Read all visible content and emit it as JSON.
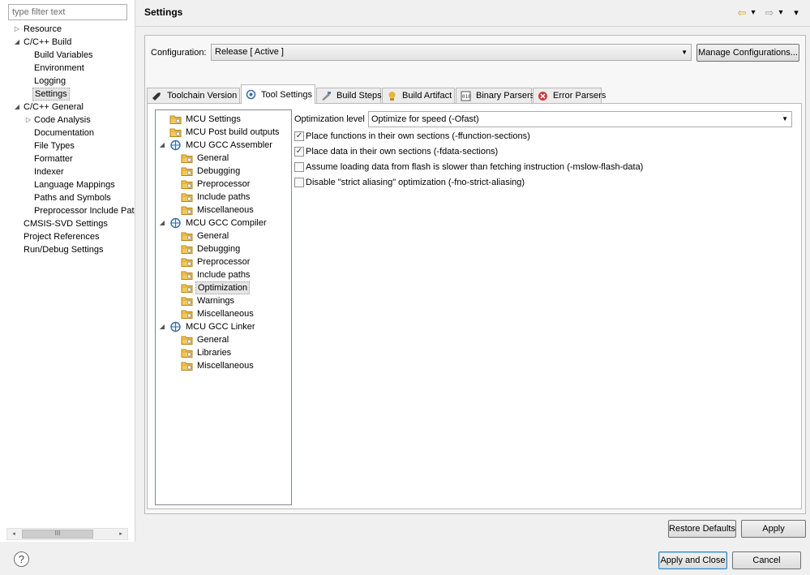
{
  "filter": {
    "placeholder": "type filter text"
  },
  "nav": {
    "items": [
      {
        "label": "Resource",
        "level": 1,
        "toggle": "▷",
        "selected": false
      },
      {
        "label": "C/C++ Build",
        "level": 1,
        "toggle": "◢",
        "selected": false
      },
      {
        "label": "Build Variables",
        "level": 2,
        "toggle": "",
        "selected": false
      },
      {
        "label": "Environment",
        "level": 2,
        "toggle": "",
        "selected": false
      },
      {
        "label": "Logging",
        "level": 2,
        "toggle": "",
        "selected": false
      },
      {
        "label": "Settings",
        "level": 2,
        "toggle": "",
        "selected": true
      },
      {
        "label": "C/C++ General",
        "level": 1,
        "toggle": "◢",
        "selected": false
      },
      {
        "label": "Code Analysis",
        "level": 2,
        "toggle": "▷",
        "selected": false
      },
      {
        "label": "Documentation",
        "level": 2,
        "toggle": "",
        "selected": false
      },
      {
        "label": "File Types",
        "level": 2,
        "toggle": "",
        "selected": false
      },
      {
        "label": "Formatter",
        "level": 2,
        "toggle": "",
        "selected": false
      },
      {
        "label": "Indexer",
        "level": 2,
        "toggle": "",
        "selected": false
      },
      {
        "label": "Language Mappings",
        "level": 2,
        "toggle": "",
        "selected": false
      },
      {
        "label": "Paths and Symbols",
        "level": 2,
        "toggle": "",
        "selected": false
      },
      {
        "label": "Preprocessor Include Pat",
        "level": 2,
        "toggle": "",
        "selected": false
      },
      {
        "label": "CMSIS-SVD Settings",
        "level": 1,
        "toggle": "",
        "selected": false
      },
      {
        "label": "Project References",
        "level": 1,
        "toggle": "",
        "selected": false
      },
      {
        "label": "Run/Debug Settings",
        "level": 1,
        "toggle": "",
        "selected": false
      }
    ]
  },
  "header": {
    "title": "Settings",
    "back_icon": "back-arrow-icon",
    "forward_icon": "forward-arrow-icon",
    "back_glyph": "⇦",
    "forward_glyph": "⇨",
    "menu_glyph": "▾"
  },
  "config": {
    "label": "Configuration:",
    "value": "Release  [ Active ]",
    "manage_label": "Manage Configurations..."
  },
  "tabs": [
    {
      "label": "Toolchain  Version",
      "icon": "toolchain-icon",
      "active": false
    },
    {
      "label": "Tool Settings",
      "icon": "tool-settings-icon",
      "active": true
    },
    {
      "label": "Build Steps",
      "icon": "build-steps-icon",
      "active": false
    },
    {
      "label": "Build Artifact",
      "icon": "build-artifact-icon",
      "active": false
    },
    {
      "label": "Binary Parsers",
      "icon": "binary-parsers-icon",
      "active": false
    },
    {
      "label": "Error Parsers",
      "icon": "error-parsers-icon",
      "active": false
    }
  ],
  "settings_tree": [
    {
      "label": "MCU Settings",
      "level": 1,
      "kind": "folder",
      "toggle": "",
      "selected": false
    },
    {
      "label": "MCU Post build outputs",
      "level": 1,
      "kind": "folder",
      "toggle": "",
      "selected": false
    },
    {
      "label": "MCU GCC Assembler",
      "level": 1,
      "kind": "tool",
      "toggle": "◢",
      "selected": false
    },
    {
      "label": "General",
      "level": 2,
      "kind": "folder",
      "toggle": "",
      "selected": false
    },
    {
      "label": "Debugging",
      "level": 2,
      "kind": "folder",
      "toggle": "",
      "selected": false
    },
    {
      "label": "Preprocessor",
      "level": 2,
      "kind": "folder",
      "toggle": "",
      "selected": false
    },
    {
      "label": "Include paths",
      "level": 2,
      "kind": "folder",
      "toggle": "",
      "selected": false
    },
    {
      "label": "Miscellaneous",
      "level": 2,
      "kind": "folder",
      "toggle": "",
      "selected": false
    },
    {
      "label": "MCU GCC Compiler",
      "level": 1,
      "kind": "tool",
      "toggle": "◢",
      "selected": false
    },
    {
      "label": "General",
      "level": 2,
      "kind": "folder",
      "toggle": "",
      "selected": false
    },
    {
      "label": "Debugging",
      "level": 2,
      "kind": "folder",
      "toggle": "",
      "selected": false
    },
    {
      "label": "Preprocessor",
      "level": 2,
      "kind": "folder",
      "toggle": "",
      "selected": false
    },
    {
      "label": "Include paths",
      "level": 2,
      "kind": "folder",
      "toggle": "",
      "selected": false
    },
    {
      "label": "Optimization",
      "level": 2,
      "kind": "folder",
      "toggle": "",
      "selected": true
    },
    {
      "label": "Warnings",
      "level": 2,
      "kind": "folder",
      "toggle": "",
      "selected": false
    },
    {
      "label": "Miscellaneous",
      "level": 2,
      "kind": "folder",
      "toggle": "",
      "selected": false
    },
    {
      "label": "MCU GCC Linker",
      "level": 1,
      "kind": "tool",
      "toggle": "◢",
      "selected": false
    },
    {
      "label": "General",
      "level": 2,
      "kind": "folder",
      "toggle": "",
      "selected": false
    },
    {
      "label": "Libraries",
      "level": 2,
      "kind": "folder",
      "toggle": "",
      "selected": false
    },
    {
      "label": "Miscellaneous",
      "level": 2,
      "kind": "folder",
      "toggle": "",
      "selected": false
    }
  ],
  "optimization": {
    "level_label": "Optimization level",
    "level_value": "Optimize for speed (-Ofast)",
    "checkboxes": [
      {
        "label": "Place functions in their own sections (-ffunction-sections)",
        "checked": true
      },
      {
        "label": "Place data in their own sections (-fdata-sections)",
        "checked": true
      },
      {
        "label": "Assume loading data from flash is slower than fetching instruction (-mslow-flash-data)",
        "checked": false
      },
      {
        "label": "Disable \"strict aliasing\" optimization (-fno-strict-aliasing)",
        "checked": false
      }
    ]
  },
  "buttons": {
    "restore_defaults": "Restore Defaults",
    "apply": "Apply",
    "apply_and_close": "Apply and Close",
    "cancel": "Cancel",
    "help": "?"
  },
  "scrollbar": {
    "left_arrow": "◂",
    "right_arrow": "▸",
    "grip": "III"
  },
  "colors": {
    "folder": "#e8b43a",
    "tool_icon": "#3a6ea5",
    "accent": "#3c7fb1"
  }
}
